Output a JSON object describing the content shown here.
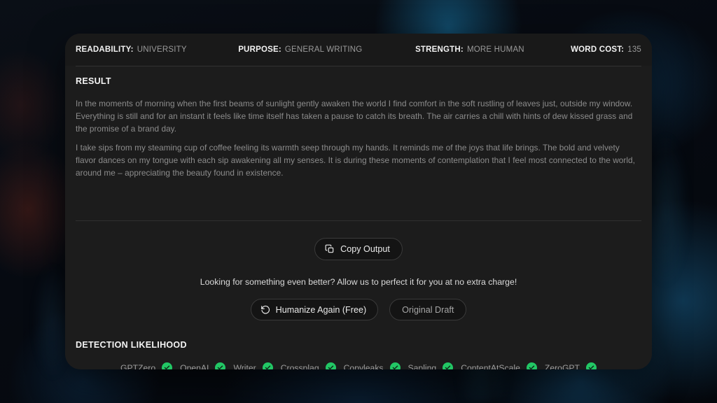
{
  "header": {
    "meta": [
      {
        "label": "READABILITY:",
        "value": "UNIVERSITY"
      },
      {
        "label": "PURPOSE:",
        "value": "GENERAL WRITING"
      },
      {
        "label": "STRENGTH:",
        "value": "MORE HUMAN"
      },
      {
        "label": "WORD COST:",
        "value": "135"
      }
    ]
  },
  "result": {
    "title": "RESULT",
    "paragraphs": [
      "In the moments of morning when the first beams of sunlight gently awaken the world I find comfort in the soft rustling of leaves just, outside my window. Everything is still and for an instant it feels like time itself has taken a pause to catch its breath. The air carries a chill with hints of dew kissed grass and the promise of a brand day.",
      "I take sips from my steaming cup of coffee feeling its warmth seep through my hands. It reminds me of the joys that life brings. The bold and velvety flavor dances on my tongue with each sip awakening all my senses. It is during these moments of contemplation that I feel most connected to the world, around me – appreciating the beauty found in existence."
    ]
  },
  "actions": {
    "copy_label": "Copy Output",
    "copy_icon": "copy-icon",
    "tagline": "Looking for something even better? Allow us to perfect it for you at no extra charge!",
    "humanize_label": "Humanize Again (Free)",
    "humanize_icon": "rotate-counterclockwise-icon",
    "original_label": "Original Draft"
  },
  "detection": {
    "title": "DETECTION LIKELIHOOD",
    "check_color": "#22c765",
    "detectors": [
      {
        "name": "GPTZero",
        "status": "check-circle-icon"
      },
      {
        "name": "OpenAI",
        "status": "check-circle-icon"
      },
      {
        "name": "Writer",
        "status": "check-circle-icon"
      },
      {
        "name": "Crossplag",
        "status": "check-circle-icon"
      },
      {
        "name": "Copyleaks",
        "status": "check-circle-icon"
      },
      {
        "name": "Sapling",
        "status": "check-circle-icon"
      },
      {
        "name": "ContentAtScale",
        "status": "check-circle-icon"
      },
      {
        "name": "ZeroGPT",
        "status": "check-circle-icon"
      }
    ]
  }
}
